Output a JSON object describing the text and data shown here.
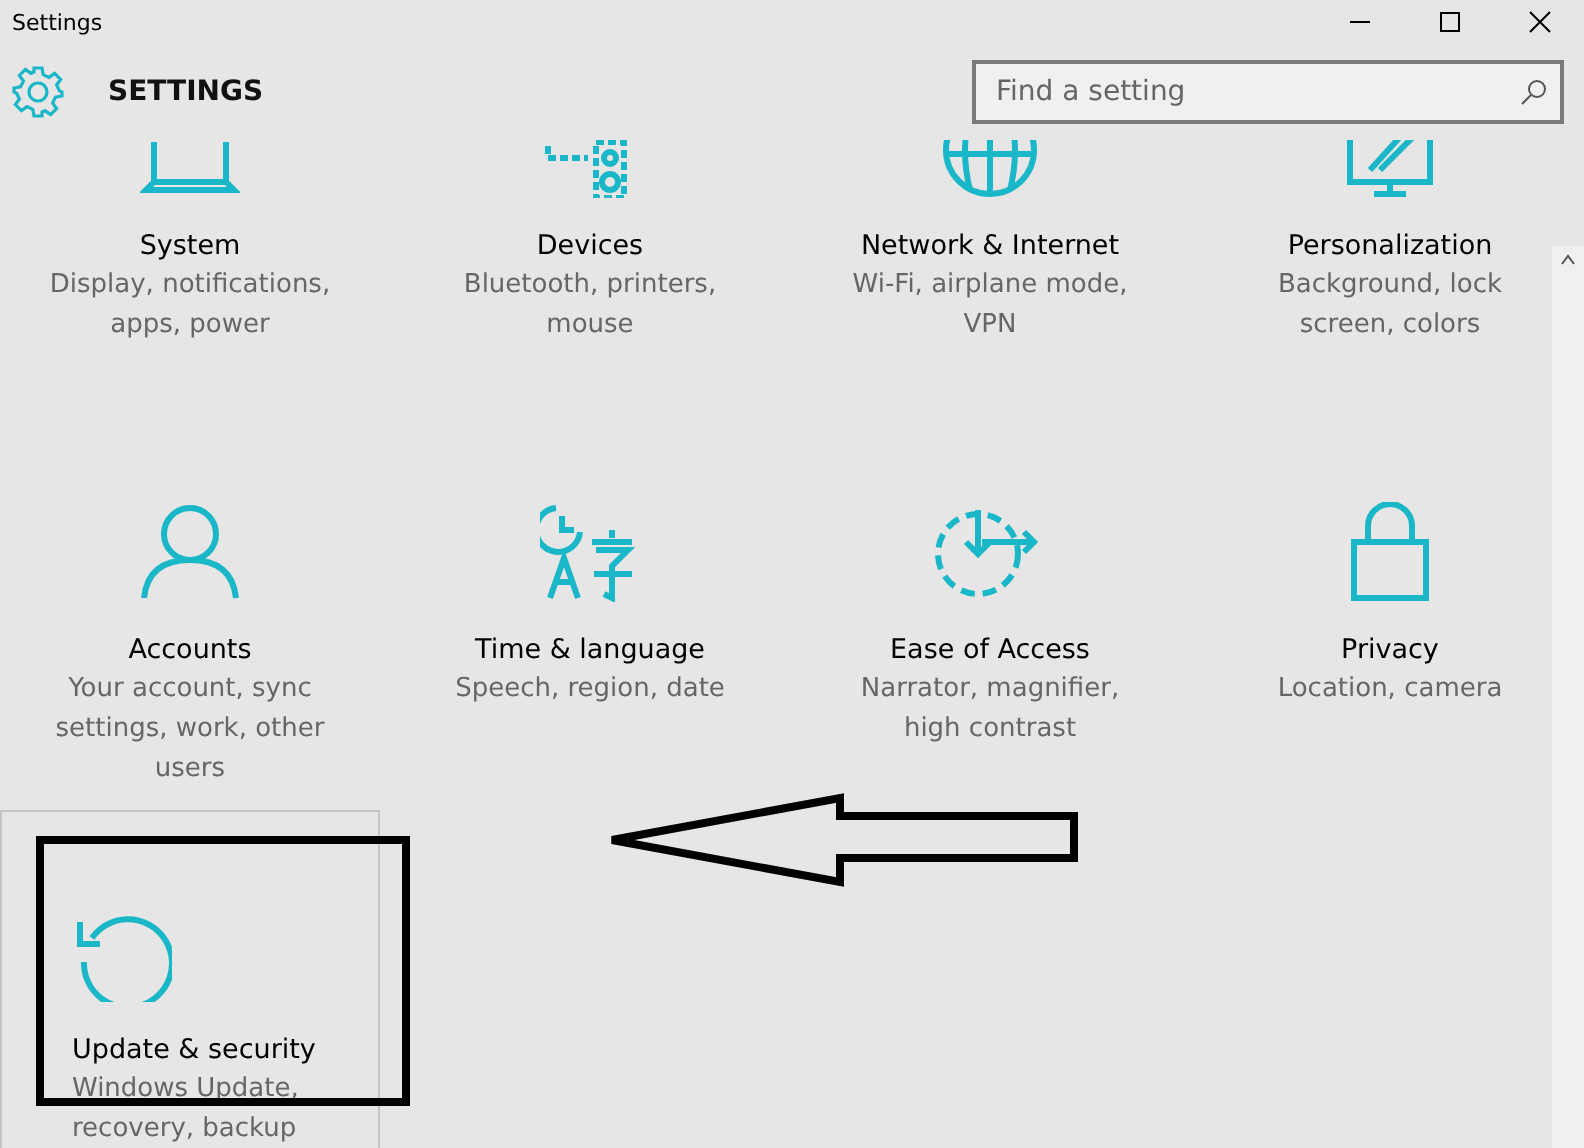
{
  "window": {
    "title": "Settings"
  },
  "header": {
    "title": "SETTINGS",
    "search": {
      "placeholder": "Find a setting"
    }
  },
  "tiles": [
    {
      "kind": "system",
      "title": "System",
      "description": "Display, notifications, apps, power",
      "hovered": false
    },
    {
      "kind": "devices",
      "title": "Devices",
      "description": "Bluetooth, printers, mouse",
      "hovered": false
    },
    {
      "kind": "network",
      "title": "Network & Internet",
      "description": "Wi-Fi, airplane mode, VPN",
      "hovered": false
    },
    {
      "kind": "personalization",
      "title": "Personalization",
      "description": "Background, lock screen, colors",
      "hovered": false
    },
    {
      "kind": "accounts",
      "title": "Accounts",
      "description": "Your account, sync settings, work, other users",
      "hovered": false
    },
    {
      "kind": "time",
      "title": "Time & language",
      "description": "Speech, region, date",
      "hovered": false
    },
    {
      "kind": "ease",
      "title": "Ease of Access",
      "description": "Narrator, magnifier, high contrast",
      "hovered": false
    },
    {
      "kind": "privacy",
      "title": "Privacy",
      "description": "Location, camera",
      "hovered": false
    },
    {
      "kind": "update",
      "title": "Update & security",
      "description": "Windows Update, recovery, backup",
      "hovered": true
    }
  ]
}
